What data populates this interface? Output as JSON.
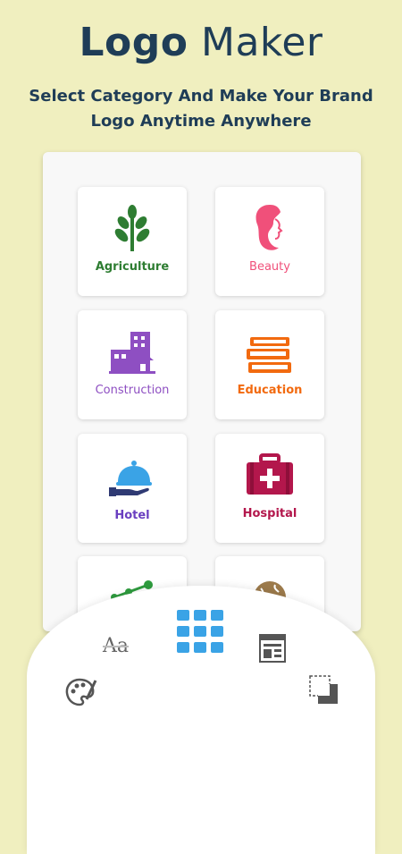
{
  "header": {
    "title_bold": "Logo",
    "title_rest": "Maker",
    "subtitle": "Select Category And Make Your Brand Logo Anytime Anywhere"
  },
  "categories": [
    {
      "label": "Agriculture",
      "icon": "leaf-sprout-icon",
      "color": "#2e7d32"
    },
    {
      "label": "Beauty",
      "icon": "woman-face-icon",
      "color": "#f0507a"
    },
    {
      "label": "Construction",
      "icon": "buildings-icon",
      "color": "#8e4fc2"
    },
    {
      "label": "Education",
      "icon": "books-stack-icon",
      "color": "#f26a0f"
    },
    {
      "label": "Hotel",
      "icon": "cloche-service-icon",
      "color": "#6a3fc0"
    },
    {
      "label": "Hospital",
      "icon": "first-aid-kit-icon",
      "color": "#b3174c"
    },
    {
      "label": "",
      "icon": "network-nodes-icon",
      "color": "#2e9b3e"
    },
    {
      "label": "",
      "icon": "globe-icon",
      "color": "#9c7a4b"
    }
  ],
  "toolbar": {
    "text_tool_label": "Aa",
    "items": [
      "text-tool-icon",
      "grid-menu-icon",
      "template-icon",
      "palette-icon",
      "layers-icon"
    ],
    "accent": "#3aa3e6"
  }
}
